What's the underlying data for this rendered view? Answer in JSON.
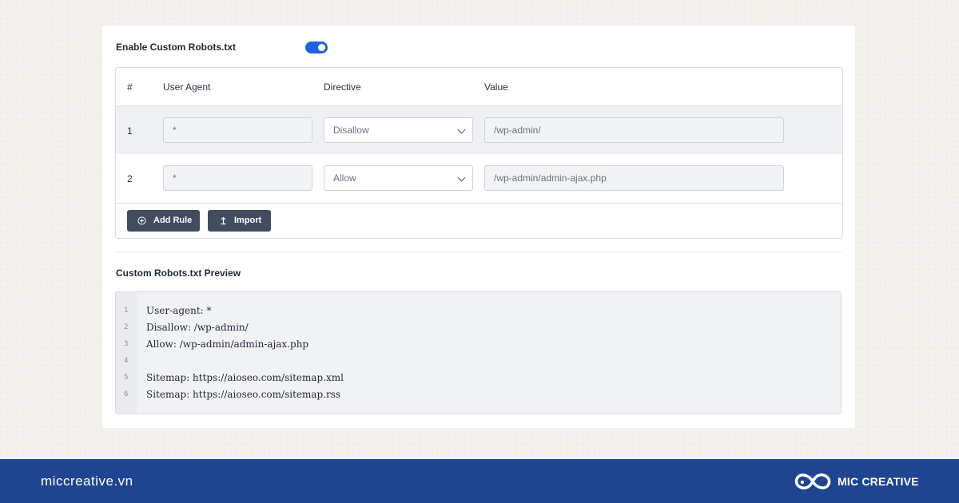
{
  "settings": {
    "toggle_label": "Enable Custom Robots.txt",
    "toggle_on": true,
    "accent_color": "#1e63e0"
  },
  "rules_table": {
    "headers": [
      "#",
      "User Agent",
      "Directive",
      "Value"
    ],
    "rows": [
      {
        "num": "1",
        "user_agent": "*",
        "directive": "Disallow",
        "value": "/wp-admin/"
      },
      {
        "num": "2",
        "user_agent": "*",
        "directive": "Allow",
        "value": "/wp-admin/admin-ajax.php"
      }
    ],
    "add_rule_label": "Add Rule",
    "import_label": "Import"
  },
  "preview": {
    "title": "Custom Robots.txt Preview",
    "lines": [
      {
        "n": "1",
        "text": "User-agent: *"
      },
      {
        "n": "2",
        "text": "Disallow: /wp-admin/"
      },
      {
        "n": "3",
        "text": "Allow: /wp-admin/admin-ajax.php"
      },
      {
        "n": "4",
        "text": ""
      },
      {
        "n": "5",
        "text": "Sitemap: https://aioseo.com/sitemap.xml"
      },
      {
        "n": "6",
        "text": "Sitemap: https://aioseo.com/sitemap.rss"
      }
    ]
  },
  "footer": {
    "site": "miccreative.vn",
    "brand": "MIC CREATIVE",
    "bar_color": "#1f4590"
  }
}
